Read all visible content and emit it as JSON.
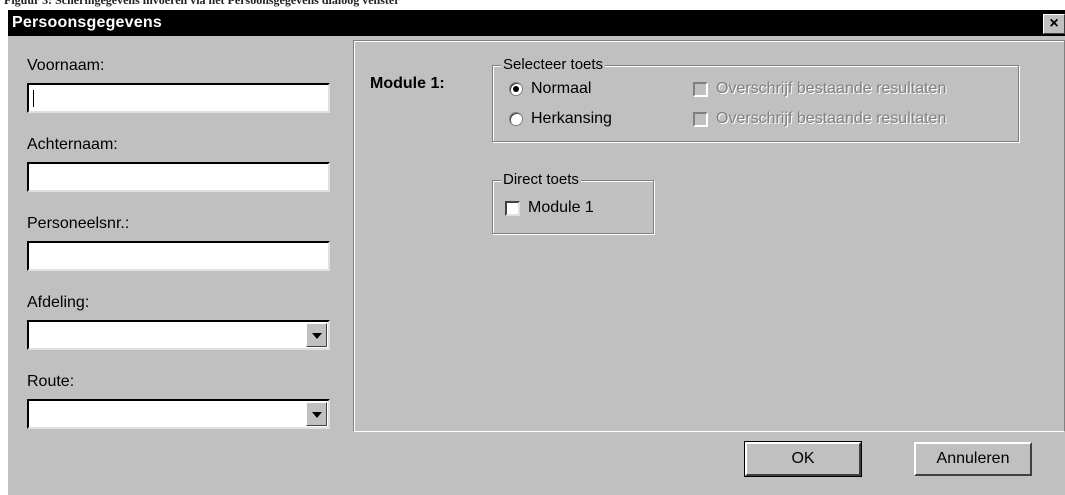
{
  "window": {
    "title": "Persoonsgegevens",
    "close_symbol": "×",
    "caption_strip": "Figuur 3: Schermgegevens invoeren via het Persoonsgegevens dialoog venster"
  },
  "form": {
    "first_name": {
      "label": "Voornaam:",
      "value": ""
    },
    "last_name": {
      "label": "Achternaam:",
      "value": ""
    },
    "employee_no": {
      "label": "Personeelsnr.:",
      "value": ""
    },
    "department": {
      "label": "Afdeling:",
      "value": ""
    },
    "route": {
      "label": "Route:",
      "value": ""
    }
  },
  "module": {
    "label": "Module 1:",
    "select_group": {
      "title": "Selecteer toets",
      "options": [
        {
          "label": "Normaal",
          "checked": true
        },
        {
          "label": "Herkansing",
          "checked": false
        }
      ],
      "overwrite": [
        {
          "label": "Overschrijf bestaande resultaten",
          "checked": false,
          "enabled": false
        },
        {
          "label": "Overschrijf bestaande resultaten",
          "checked": false,
          "enabled": false
        }
      ]
    },
    "direct_group": {
      "title": "Direct toets",
      "checkbox_label": "Module 1",
      "checked": false
    }
  },
  "buttons": {
    "ok": "OK",
    "cancel": "Annuleren"
  },
  "icons": {
    "radio_selected": "radio-selected-icon",
    "dropdown_arrow": "chevron-down-icon"
  },
  "colors": {
    "titlebar": "#000000",
    "dialog_face": "#c0c0c0",
    "field_bg": "#ffffff",
    "disabled_text": "#808080"
  }
}
